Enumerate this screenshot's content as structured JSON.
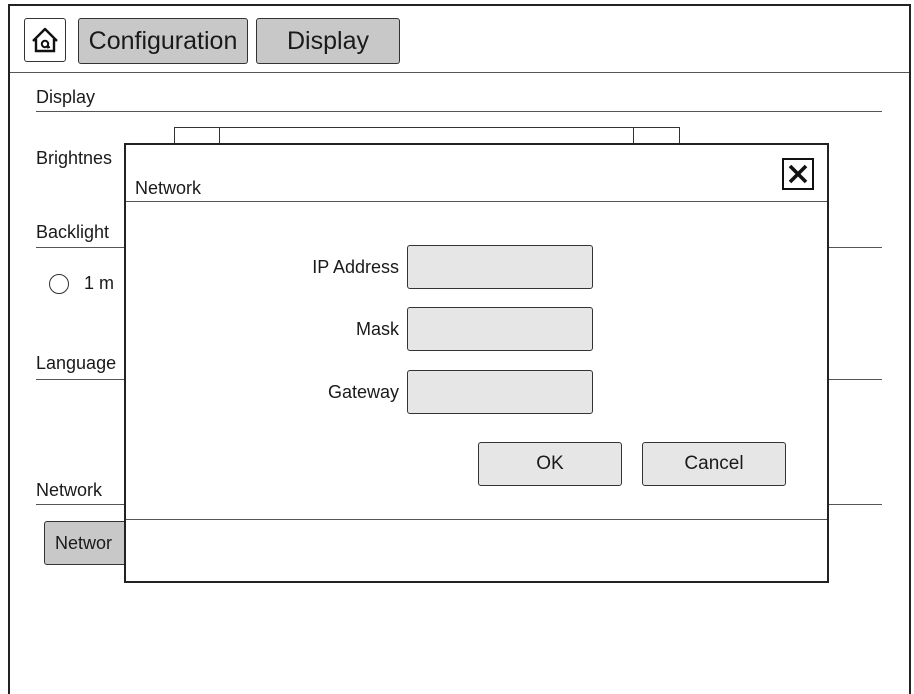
{
  "header": {
    "home_icon": "home-icon",
    "tabs": [
      {
        "label": "Configuration"
      },
      {
        "label": "Display"
      }
    ]
  },
  "background": {
    "display_heading": "Display",
    "brightness_label": "Brightnes",
    "backlight_label": "Backlight",
    "backlight_option": "1 m",
    "language_label": "Language",
    "network_heading": "Network",
    "network_button": "Networ"
  },
  "dialog": {
    "title": "Network",
    "close_icon": "close-icon",
    "fields": {
      "ip_label": "IP Address",
      "ip_value": "",
      "mask_label": "Mask",
      "mask_value": "",
      "gateway_label": "Gateway",
      "gateway_value": ""
    },
    "ok_label": "OK",
    "cancel_label": "Cancel"
  },
  "colors": {
    "tab_bg": "#c8c8c8",
    "input_bg": "#e6e6e6",
    "border": "#222222"
  }
}
